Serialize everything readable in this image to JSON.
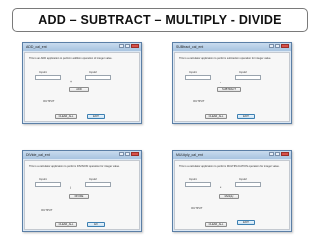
{
  "title": "ADD – SUBTRACT – MULTIPLY - DIVIDE",
  "windows": [
    {
      "title": "ADD_cal_ent",
      "description": "This is an ADD application to perform addition operation of integer value.",
      "input1_label": "Input1",
      "input2_label": "Input2",
      "operator": "+",
      "op_button": "ADD",
      "output_label": "OUTPUT",
      "clear_button": "CLEAR_ALL",
      "exit_button": "EXIT"
    },
    {
      "title": "SUBtract_cal_ent",
      "description": "This is a calculator application to perform subtraction operation for integer value.",
      "input1_label": "Input1",
      "input2_label": "Input2",
      "operator": "-",
      "op_button": "SUBTRACT",
      "output_label": "OUTPUT",
      "clear_button": "CLEAR_ALL",
      "exit_button": "EXIT"
    },
    {
      "title": "DIVide_cal_ent",
      "description": "This is a calculator application to perform DIVISION operation for integer value.",
      "input1_label": "Input1",
      "input2_label": "Input2",
      "operator": "/",
      "op_button": "DIVIDE",
      "output_label": "OUTPUT",
      "clear_button": "CLEAR_ALL",
      "exit_button": "EX"
    },
    {
      "title": "MULtiply_cal_ent",
      "description": "This is a calculator application to perform MULTIPLICATION operation for integer value.",
      "input1_label": "Input1",
      "input2_label": "Input2",
      "operator": "*",
      "op_button": "Multiply",
      "output_label": "OUTPUT",
      "clear_button": "CLEAR_ALL",
      "exit_button": "EXIT"
    }
  ]
}
